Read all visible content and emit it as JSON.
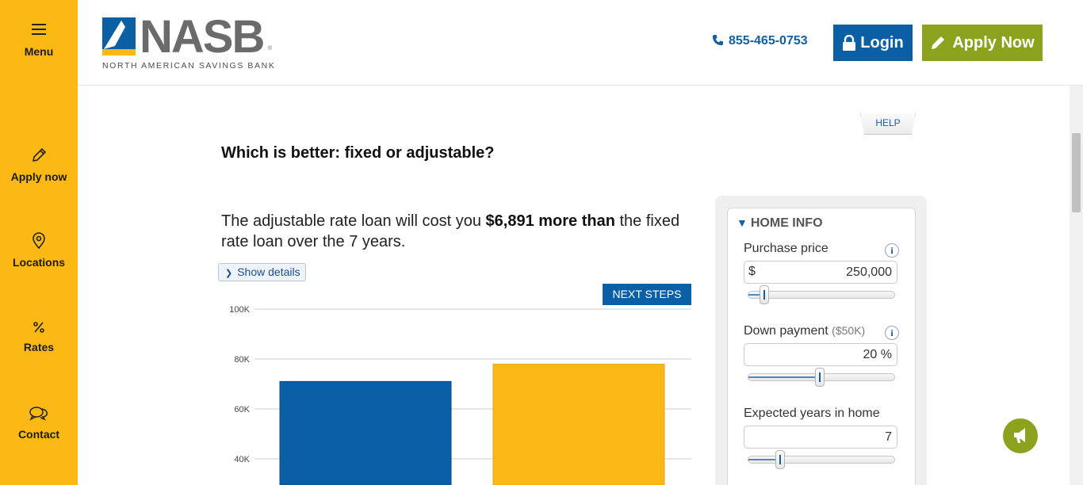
{
  "rail": {
    "items": [
      {
        "label": "Menu",
        "icon": "hamburger-icon"
      },
      {
        "label": "Apply now",
        "icon": "pencil-icon"
      },
      {
        "label": "Locations",
        "icon": "map-pin-icon"
      },
      {
        "label": "Rates",
        "icon": "percent-icon"
      },
      {
        "label": "Contact",
        "icon": "chat-bubbles-icon"
      }
    ],
    "color": "#fdb913"
  },
  "header": {
    "logo_text": "NASB",
    "logo_reg": "®",
    "logo_subtitle": "NORTH AMERICAN SAVINGS BANK",
    "phone": "855-465-0753",
    "login_label": "Login",
    "apply_label": "Apply Now",
    "colors": {
      "blue": "#0b5fa5",
      "green": "#8ba21e"
    }
  },
  "main": {
    "help_label": "HELP",
    "question": "Which is better: fixed or adjustable?",
    "result_prefix": "The adjustable rate loan will cost you ",
    "result_amount": "$6,891 more than",
    "result_suffix": " the fixed rate loan over the 7 years.",
    "show_details_label": "Show details",
    "next_steps_label": "NEXT STEPS"
  },
  "chart_data": {
    "type": "bar",
    "categories": [
      "",
      ""
    ],
    "values": [
      71000,
      77900
    ],
    "colors": [
      "#0b5fa5",
      "#fbb716"
    ],
    "y_ticks": [
      "100K",
      "80K",
      "60K",
      "40K"
    ],
    "ylim_visible": [
      35000,
      100000
    ],
    "grid": true,
    "title": "",
    "xlabel": "",
    "ylabel": ""
  },
  "panel": {
    "title": "HOME INFO",
    "fields": [
      {
        "label": "Purchase price",
        "extra": "",
        "prefix": "$",
        "value": "250,000",
        "slider_fraction": 0.11,
        "info": "i"
      },
      {
        "label": "Down payment",
        "extra": "($50K)",
        "prefix": "",
        "value": "20 %",
        "slider_fraction": 0.49,
        "info": "i"
      },
      {
        "label": "Expected years in home",
        "extra": "",
        "prefix": "",
        "value": "7",
        "slider_fraction": 0.22,
        "info": ""
      }
    ]
  },
  "feedback": {
    "icon": "megaphone-icon",
    "label": "Feedback"
  }
}
